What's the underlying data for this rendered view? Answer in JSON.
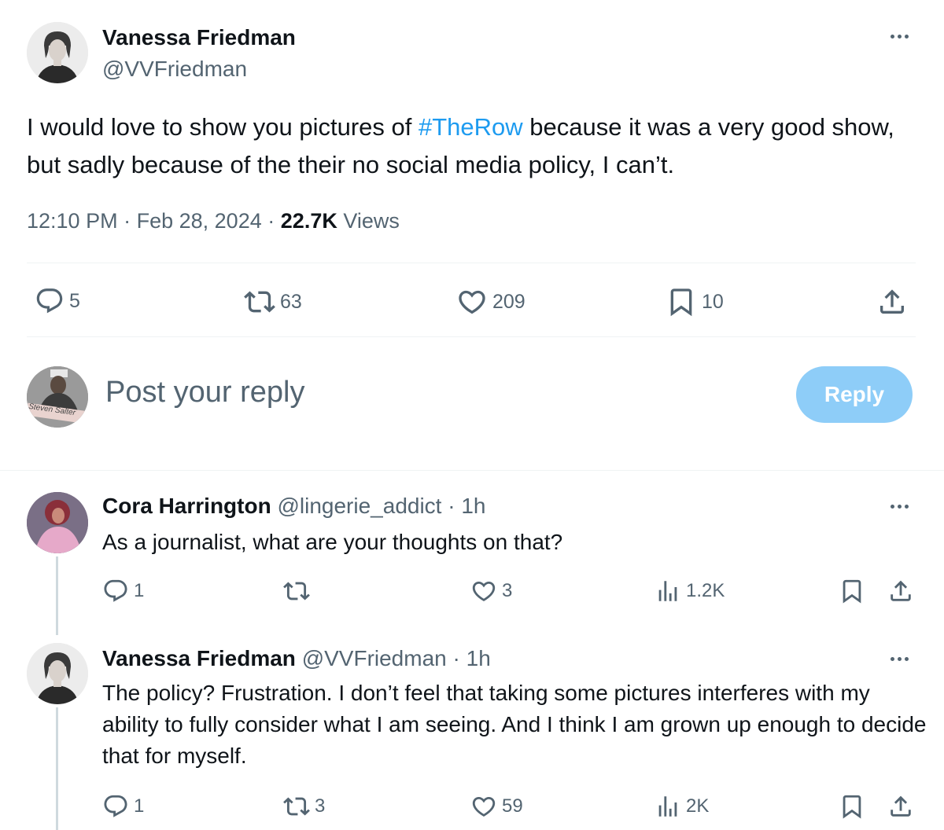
{
  "main_tweet": {
    "author_name": "Vanessa Friedman",
    "author_handle": "@VVFriedman",
    "text_before": "I would love to show you pictures of ",
    "hashtag": "#TheRow",
    "text_after": " because it was a very good show, but sadly because of the their no social media policy, I can’t.",
    "time": "12:10 PM",
    "date": "Feb 28, 2024",
    "separator": "·",
    "views_count": "22.7K",
    "views_label": "Views",
    "replies": "5",
    "reposts": "63",
    "likes": "209",
    "bookmarks": "10"
  },
  "composer": {
    "placeholder": "Post your reply",
    "button_label": "Reply",
    "avatar_caption": "Steven Salter"
  },
  "replies": [
    {
      "author_name": "Cora Harrington",
      "author_handle": "@lingerie_addict",
      "time": "· 1h",
      "text": "As a journalist, what are your thoughts on that?",
      "replies": "1",
      "reposts": "",
      "likes": "3",
      "views": "1.2K"
    },
    {
      "author_name": "Vanessa Friedman",
      "author_handle": "@VVFriedman",
      "time": "· 1h",
      "text": "The policy? Frustration. I don’t feel that taking some pictures interferes with my ability to fully consider what I am seeing. And I think I am grown up enough to decide that for myself.",
      "replies": "1",
      "reposts": "3",
      "likes": "59",
      "views": "2K"
    }
  ],
  "colors": {
    "accent": "#1d9bf0",
    "reply_button_disabled": "#8ecdf8",
    "muted_text": "#536471",
    "divider": "#eff3f4"
  },
  "icons": [
    "more-icon",
    "reply-icon",
    "repost-icon",
    "like-icon",
    "bookmark-icon",
    "share-icon",
    "views-icon"
  ]
}
